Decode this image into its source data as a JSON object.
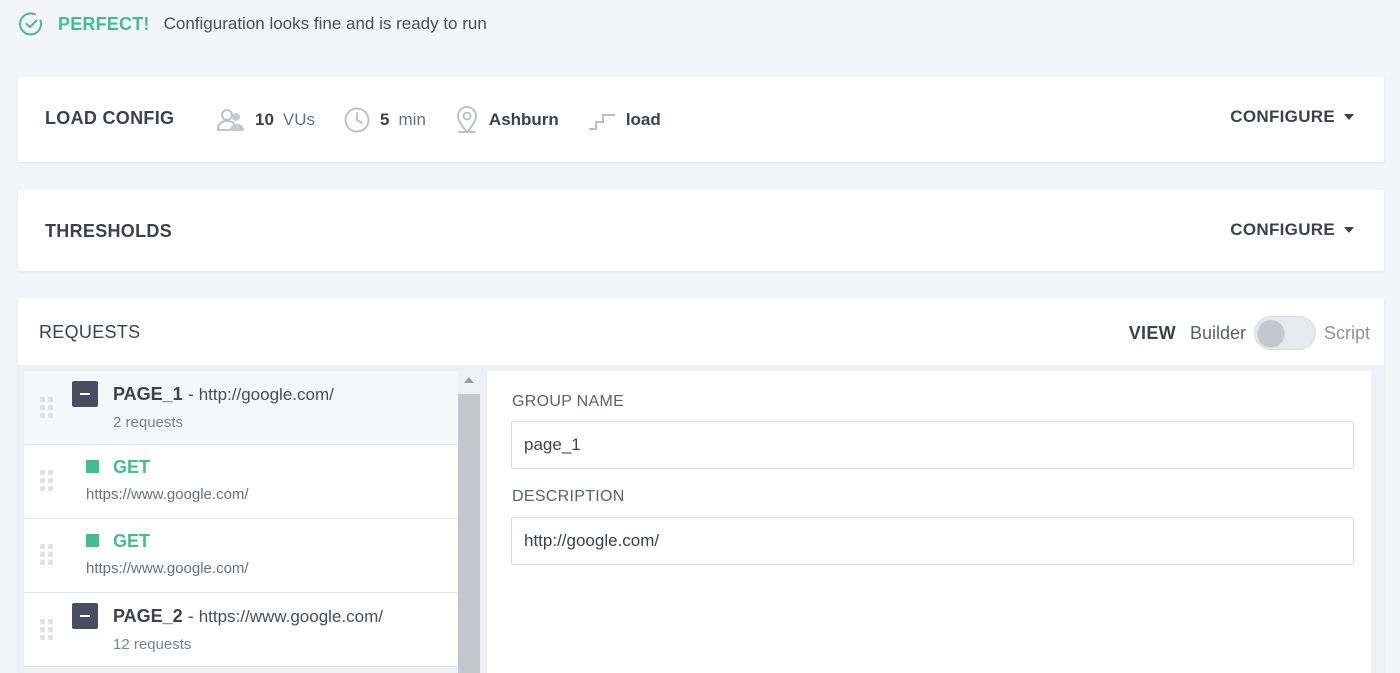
{
  "status": {
    "icon": "check-circle-icon",
    "word": "PERFECT!",
    "message": "Configuration looks fine and is ready to run",
    "color": "#3ebf8c"
  },
  "load_config": {
    "title": "LOAD CONFIG",
    "vus": {
      "icon": "users-icon",
      "value": "10",
      "unit": "VUs"
    },
    "duration": {
      "icon": "clock-icon",
      "value": "5",
      "unit": "min"
    },
    "location": {
      "icon": "location-pin-icon",
      "value": "Ashburn"
    },
    "profile": {
      "icon": "ramp-steps-icon",
      "value": "load"
    },
    "configure_label": "CONFIGURE"
  },
  "thresholds": {
    "title": "THRESHOLDS",
    "configure_label": "CONFIGURE"
  },
  "requests": {
    "title": "REQUESTS",
    "view_label": "VIEW",
    "view_options": {
      "builder": "Builder",
      "script": "Script"
    },
    "view_selected": "Builder",
    "items": [
      {
        "kind": "group",
        "name": "PAGE_1",
        "separator": " - ",
        "url": "http://google.com/",
        "count": "2 requests"
      },
      {
        "kind": "request",
        "method": "GET",
        "url": "https://www.google.com/"
      },
      {
        "kind": "request",
        "method": "GET",
        "url": "https://www.google.com/"
      },
      {
        "kind": "group",
        "name": "PAGE_2",
        "separator": " - ",
        "url": "https://www.google.com/",
        "count": "12 requests"
      }
    ],
    "detail": {
      "group_name_label": "GROUP NAME",
      "group_name_value": "page_1",
      "description_label": "DESCRIPTION",
      "description_value": "http://google.com/"
    }
  }
}
